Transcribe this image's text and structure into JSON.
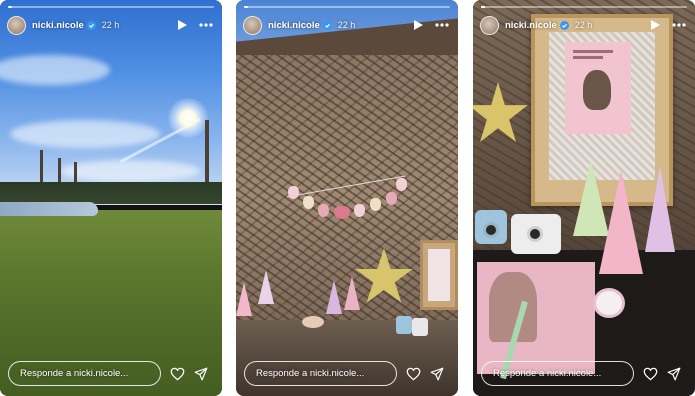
{
  "stories": [
    {
      "username": "nicki.nicole",
      "time_ago": "22 h",
      "progress": 0.02,
      "reply_placeholder": "Responde a nicki.nicole...",
      "icons": {
        "verified": "verified-badge-icon",
        "play": "play-icon",
        "more": "more-options-icon",
        "like": "heart-icon",
        "share": "send-icon"
      }
    },
    {
      "username": "nicki.nicole",
      "time_ago": "22 h",
      "progress": 0.02,
      "reply_placeholder": "Responde a nicki.nicole...",
      "icons": {
        "verified": "verified-badge-icon",
        "play": "play-icon",
        "more": "more-options-icon",
        "like": "heart-icon",
        "share": "send-icon"
      }
    },
    {
      "username": "nicki.nicole",
      "time_ago": "22 h",
      "progress": 0.02,
      "reply_placeholder": "Responde a nicki.nicole...",
      "icons": {
        "verified": "verified-badge-icon",
        "play": "play-icon",
        "more": "more-options-icon",
        "like": "heart-icon",
        "share": "send-icon"
      }
    }
  ],
  "colors": {
    "ui_foreground": "#ffffff",
    "verified_badge": "#3897f0",
    "page_background": "#ffffff"
  }
}
